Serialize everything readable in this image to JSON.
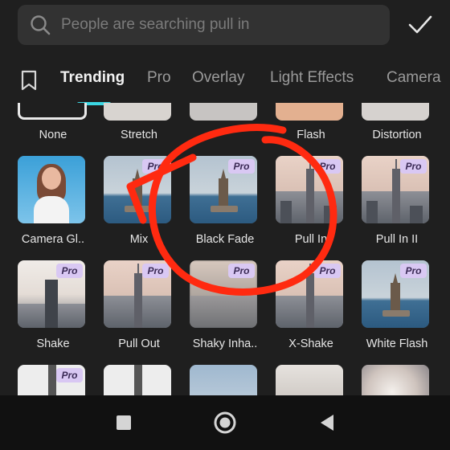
{
  "search": {
    "placeholder": "People are searching pull in",
    "value": ""
  },
  "tabs": [
    {
      "label": "Trending",
      "active": true
    },
    {
      "label": "Pro",
      "active": false
    },
    {
      "label": "Overlay",
      "active": false
    },
    {
      "label": "Light Effects",
      "active": false
    },
    {
      "label": "Camera",
      "active": false
    }
  ],
  "row0": [
    "None",
    "Stretch",
    "",
    "Flash",
    "Distortion"
  ],
  "row1": [
    {
      "label": "Camera Gl..",
      "pro": false
    },
    {
      "label": "Mix",
      "pro": true
    },
    {
      "label": "Black Fade",
      "pro": true
    },
    {
      "label": "Pull In",
      "pro": true
    },
    {
      "label": "Pull In II",
      "pro": true
    }
  ],
  "row2": [
    {
      "label": "Shake",
      "pro": true
    },
    {
      "label": "Pull Out",
      "pro": true
    },
    {
      "label": "Shaky Inha..",
      "pro": true
    },
    {
      "label": "X-Shake",
      "pro": true
    },
    {
      "label": "White Flash",
      "pro": true
    }
  ],
  "badge_text": "Pro",
  "colors": {
    "accent": "#3bd7e3",
    "pro_badge": "#d9c8f3",
    "scribble": "#ff2a10"
  },
  "icons": [
    "search-icon",
    "check-icon",
    "bookmark-icon",
    "square-icon",
    "circle-home-icon",
    "back-triangle-icon"
  ]
}
